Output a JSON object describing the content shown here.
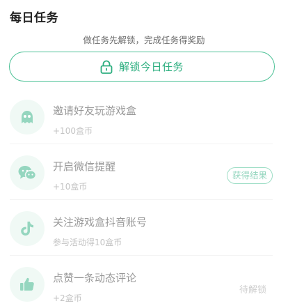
{
  "header": {
    "title": "每日任务"
  },
  "unlock": {
    "hint": "做任务先解锁，完成任务得奖励",
    "button_label": "解锁今日任务"
  },
  "colors": {
    "accent": "#2eaf80",
    "accent_border": "#4cc196",
    "icon_bg": "#e3f5ec"
  },
  "tasks": [
    {
      "icon": "ghost-icon",
      "name": "邀请好友玩游戏盒",
      "reward": "+100盒币",
      "action": ""
    },
    {
      "icon": "wechat-icon",
      "name": "开启微信提醒",
      "reward": "+10盒币",
      "action": "获得结果"
    },
    {
      "icon": "tiktok-icon",
      "name": "关注游戏盒抖音账号",
      "reward": "参与活动得10盒币",
      "action": ""
    },
    {
      "icon": "thumbs-up-icon",
      "name": "点赞一条动态评论",
      "reward": "+2盒币",
      "action": "待解锁"
    }
  ]
}
